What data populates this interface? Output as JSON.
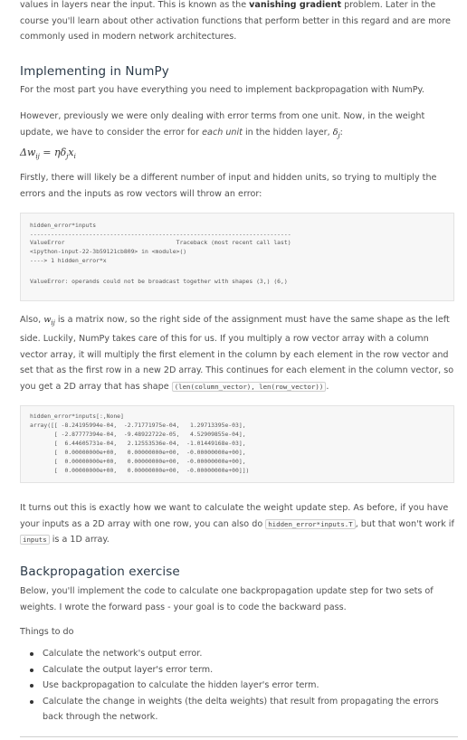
{
  "intro": {
    "pre": "values in layers near the input. This is known as the ",
    "bold": "vanishing gradient",
    "post": " problem. Later in the course you'll learn about other activation functions that perform better in this regard and are more commonly used in modern network architectures."
  },
  "section1": {
    "heading": "Implementing in NumPy",
    "p1": "For the most part you have everything you need to implement backpropagation with NumPy.",
    "p2_pre": "However, previously we were only dealing with error terms from one unit. Now, in the weight update, we have to consider the error for ",
    "p2_em": "each unit",
    "p2_post": " in the hidden layer, ",
    "formula": "Δw_ij = ηδ_j x_i",
    "p3": "Firstly, there will likely be a different number of input and hidden units, so trying to multiply the errors and the inputs as row vectors will throw an error:",
    "code1": [
      "hidden_error*inputs",
      "---------------------------------------------------------------------------",
      "ValueError                                Traceback (most recent call last)",
      "<ipython-input-22-3b59121cb809> in <module>()",
      "----> 1 hidden_error*x",
      "",
      "ValueError: operands could not be broadcast together with shapes (3,) (6,)"
    ],
    "p4_pre": "Also, ",
    "p4_post": " is a matrix now, so the right side of the assignment must have the same shape as the left side. Luckily, NumPy takes care of this for us. If you multiply a row vector array with a column vector array, it will multiply the first element in the column by each element in the row vector and set that as the first row in a new 2D array. This continues for each element in the column vector, so you get a 2D array that has shape ",
    "p4_code": "(len(column_vector), len(row_vector))",
    "p4_end": ".",
    "code2": [
      "hidden_error*inputs[:,None]",
      "array([[ -8.24195994e-04,  -2.71771975e-04,   1.29713395e-03],",
      "       [ -2.87777394e-04,  -9.48922722e-05,   4.52909855e-04],",
      "       [  6.44605731e-04,   2.12553536e-04,  -1.01449168e-03],",
      "       [  0.00000000e+00,   0.00000000e+00,  -0.00000000e+00],",
      "       [  0.00000000e+00,   0.00000000e+00,  -0.00000000e+00],",
      "       [  0.00000000e+00,   0.00000000e+00,  -0.00000000e+00]])"
    ],
    "p5_pre": "It turns out this is exactly how we want to calculate the weight update step. As before, if you have your inputs as a 2D array with one row, you can also do ",
    "p5_code": "hidden_error*inputs.T",
    "p5_mid": ", but that won't work if ",
    "p5_code2": "inputs",
    "p5_end": " is a 1D array."
  },
  "section2": {
    "heading": "Backpropagation exercise",
    "p1": "Below, you'll implement the code to calculate one backpropagation update step for two sets of weights. I wrote the forward pass - your goal is to code the backward pass.",
    "p2": "Things to do",
    "items": [
      "Calculate the network's output error.",
      "Calculate the output layer's error term.",
      "Use backpropagation to calculate the hidden layer's error term.",
      "Calculate the change in weights (the delta weights) that result from propagating the errors back through the network."
    ]
  }
}
